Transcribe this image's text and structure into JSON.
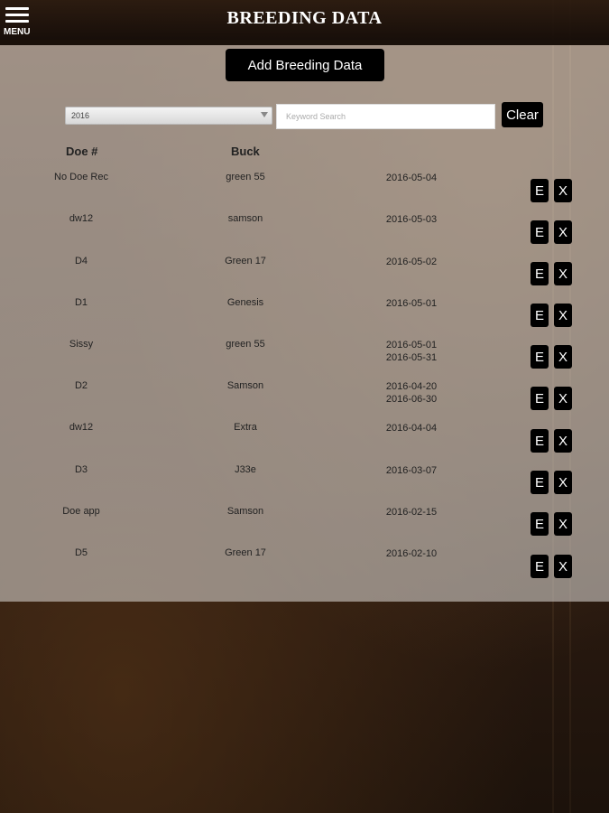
{
  "header": {
    "title": "BREEDING DATA",
    "menu_label": "MENU"
  },
  "toolbar": {
    "add_label": "Add Breeding Data",
    "clear_label": "Clear"
  },
  "filter": {
    "year_value": "2016",
    "search_placeholder": "Keyword Search"
  },
  "table": {
    "columns": {
      "doe": "Doe #",
      "buck": "Buck"
    },
    "edit_label": "E",
    "delete_label": "X",
    "rows": [
      {
        "doe": "No Doe Rec",
        "buck": "green 55",
        "date": "2016-05-04",
        "date2": ""
      },
      {
        "doe": "dw12",
        "buck": "samson",
        "date": "2016-05-03",
        "date2": ""
      },
      {
        "doe": "D4",
        "buck": "Green 17",
        "date": "2016-05-02",
        "date2": ""
      },
      {
        "doe": "D1",
        "buck": "Genesis",
        "date": "2016-05-01",
        "date2": ""
      },
      {
        "doe": "Sissy",
        "buck": "green 55",
        "date": "2016-05-01",
        "date2": "2016-05-31"
      },
      {
        "doe": "D2",
        "buck": "Samson",
        "date": "2016-04-20",
        "date2": "2016-06-30"
      },
      {
        "doe": "dw12",
        "buck": "Extra",
        "date": "2016-04-04",
        "date2": ""
      },
      {
        "doe": "D3",
        "buck": "J33e",
        "date": "2016-03-07",
        "date2": ""
      },
      {
        "doe": "Doe app",
        "buck": "Samson",
        "date": "2016-02-15",
        "date2": ""
      },
      {
        "doe": "D5",
        "buck": "Green 17",
        "date": "2016-02-10",
        "date2": ""
      }
    ]
  }
}
